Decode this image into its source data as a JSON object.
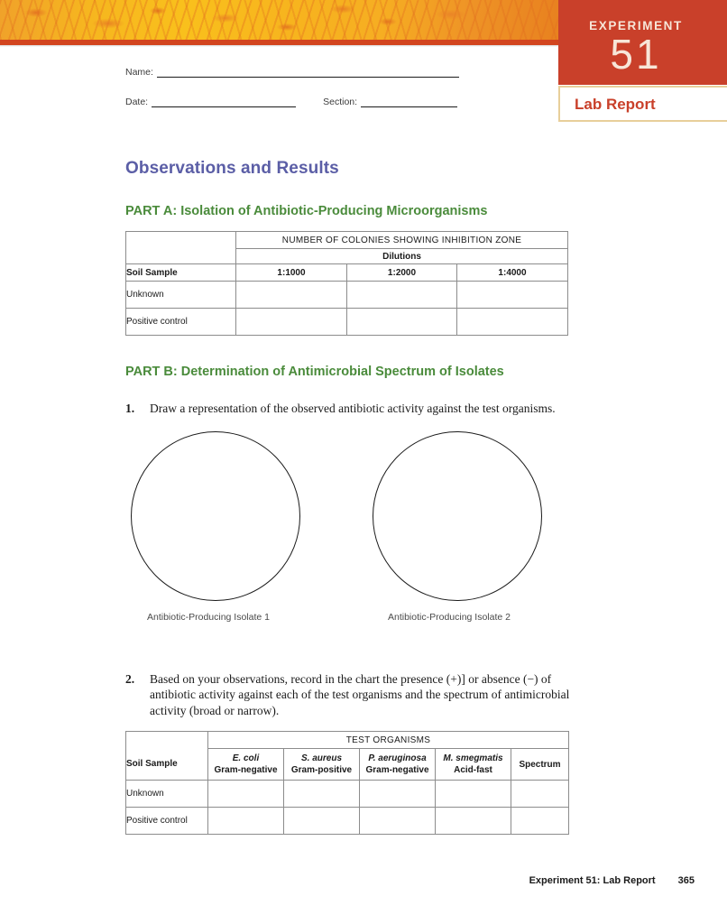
{
  "header": {
    "experiment_word": "EXPERIMENT",
    "experiment_number": "51",
    "lab_report_label": "Lab Report",
    "banner_icon": "bacterial-culture-photo",
    "accent_red": "#c9402a",
    "accent_orange": "#f6b61f",
    "border_tan": "#e8cf9a"
  },
  "identity": {
    "name_label": "Name:",
    "name_value": "",
    "date_label": "Date:",
    "date_value": "",
    "section_label": "Section:",
    "section_value": ""
  },
  "main": {
    "heading": "Observations and Results",
    "heading_color": "#5b5ea6",
    "part_color": "#4a8b3b",
    "part_a": {
      "heading": "PART A: Isolation of Antibiotic-Producing Microorganisms",
      "table": {
        "caption": "NUMBER OF COLONIES SHOWING INHIBITION ZONE",
        "subcaption": "Dilutions",
        "row_header": "Soil Sample",
        "columns": [
          "1:1000",
          "1:2000",
          "1:4000"
        ],
        "rows": [
          {
            "label": "Unknown",
            "cells": [
              "",
              "",
              ""
            ]
          },
          {
            "label": "Positive control",
            "cells": [
              "",
              "",
              ""
            ]
          }
        ]
      }
    },
    "part_b": {
      "heading": "PART B: Determination of Antimicrobial Spectrum of Isolates",
      "items": [
        {
          "number": "1.",
          "text": "Draw a representation of the observed antibiotic activity against the test organisms."
        },
        {
          "number": "2.",
          "text": "Based on your observations, record in the chart the presence (+)] or absence (−) of antibiotic activity against each of the test organisms and the spectrum of antimicrobial activity (broad or narrow)."
        }
      ],
      "plates": [
        {
          "caption": "Antibiotic-Producing Isolate 1"
        },
        {
          "caption": "Antibiotic-Producing Isolate 2"
        }
      ],
      "table": {
        "caption": "TEST ORGANISMS",
        "row_header": "Soil Sample",
        "spectrum_header": "Spectrum",
        "organisms": [
          {
            "name": "E. coli",
            "gram": "Gram-negative"
          },
          {
            "name": "S. aureus",
            "gram": "Gram-positive"
          },
          {
            "name": "P. aeruginosa",
            "gram": "Gram-negative"
          },
          {
            "name": "M. smegmatis",
            "gram": "Acid-fast"
          }
        ],
        "rows": [
          {
            "label": "Unknown",
            "cells": [
              "",
              "",
              "",
              "",
              ""
            ]
          },
          {
            "label": "Positive control",
            "cells": [
              "",
              "",
              "",
              "",
              ""
            ]
          }
        ]
      }
    }
  },
  "footer": {
    "text": "Experiment 51: Lab Report",
    "page": "365"
  }
}
